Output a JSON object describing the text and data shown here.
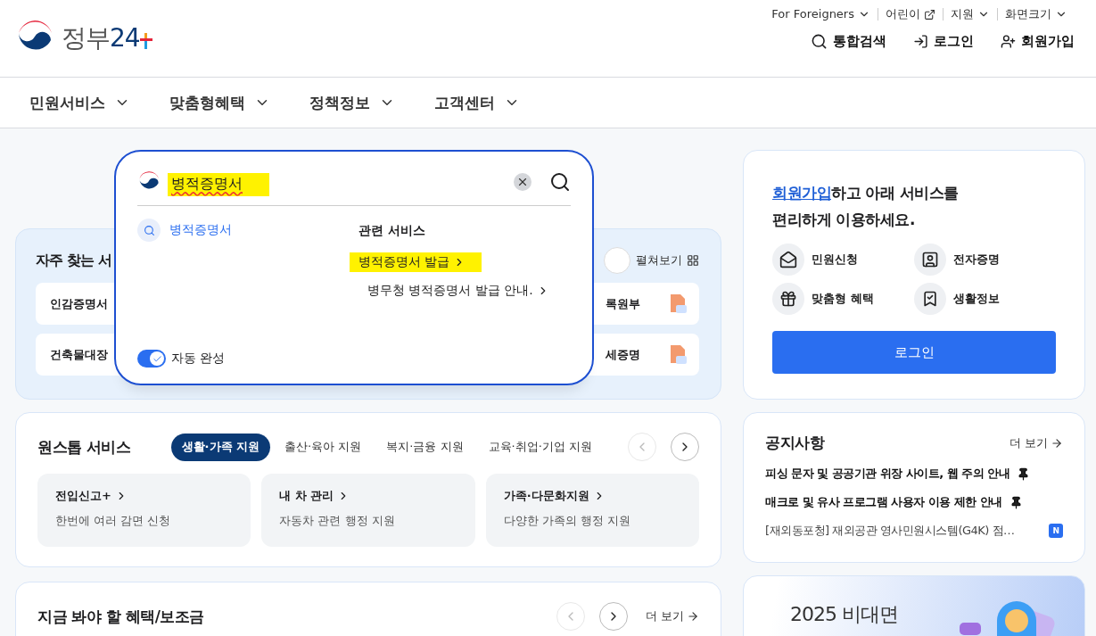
{
  "header": {
    "logo": {
      "name": "정부",
      "number": "24"
    },
    "utility_links": [
      {
        "label": "For Foreigners",
        "kind": "dropdown"
      },
      {
        "label": "어린이",
        "kind": "external"
      },
      {
        "label": "지원",
        "kind": "dropdown"
      },
      {
        "label": "화면크기",
        "kind": "dropdown"
      }
    ],
    "actions": [
      {
        "label": "통합검색",
        "kind": "search"
      },
      {
        "label": "로그인",
        "kind": "login"
      },
      {
        "label": "회원가입",
        "kind": "signup"
      }
    ]
  },
  "nav": [
    "민원서비스",
    "맞춤형혜택",
    "정책정보",
    "고객센터"
  ],
  "search_popup": {
    "query": "병적증명서",
    "suggestions": [
      "병적증명서"
    ],
    "related_title": "관련 서비스",
    "related": [
      {
        "label": "병적증명서 발급",
        "highlighted": true
      },
      {
        "label": "병무청 병적증명서 발급 안내.",
        "highlighted": false
      }
    ],
    "autocomplete": {
      "label": "자동 완성",
      "on": true
    }
  },
  "frequent": {
    "title": "자주 찾는 서",
    "expand": "펼쳐보기",
    "rows": [
      {
        "left": "인감증명서",
        "right": "록원부"
      },
      {
        "left": "건축물대장",
        "right": "세증명"
      }
    ]
  },
  "one_stop": {
    "title": "원스톱 서비스",
    "tabs": [
      {
        "label": "생활·가족 지원",
        "selected": true
      },
      {
        "label": "출산·육아 지원",
        "selected": false
      },
      {
        "label": "복지·금융 지원",
        "selected": false
      },
      {
        "label": "교육·취업·기업 지원",
        "selected": false
      }
    ],
    "cards": [
      {
        "title": "전입신고+",
        "desc": "한번에 여러 감면 신청"
      },
      {
        "title": "내 차 관리",
        "desc": "자동차 관련 행정 지원"
      },
      {
        "title": "가족·다문화지원",
        "desc": "다양한 가족의 행정 지원"
      }
    ]
  },
  "benefits": {
    "title": "지금 봐야 할 혜택/보조금",
    "more": "더 보기"
  },
  "member": {
    "link": "회원가입",
    "text": "하고 아래 서비스를 편리하게 이용하세요.",
    "services": [
      {
        "label": "민원신청",
        "kind": "mail"
      },
      {
        "label": "전자증명",
        "kind": "id"
      },
      {
        "label": "맞춤형 혜택",
        "kind": "gift"
      },
      {
        "label": "생활정보",
        "kind": "book"
      }
    ],
    "login": "로그인"
  },
  "notices": {
    "title": "공지사항",
    "more": "더 보기",
    "items": [
      {
        "title": "피싱 문자 및 공공기관 위장 사이트, 웹 주의 안내",
        "pinned": true
      },
      {
        "title": "매크로 및 유사 프로그램 사용자 이용 제한 안내",
        "pinned": true
      },
      {
        "title": "[재외동포청] 재외공관 영사민원시스템(G4K) 점…",
        "pinned": false,
        "badge": "N"
      }
    ]
  },
  "banner": {
    "title": "2025 비대면",
    "kind": "picture"
  }
}
